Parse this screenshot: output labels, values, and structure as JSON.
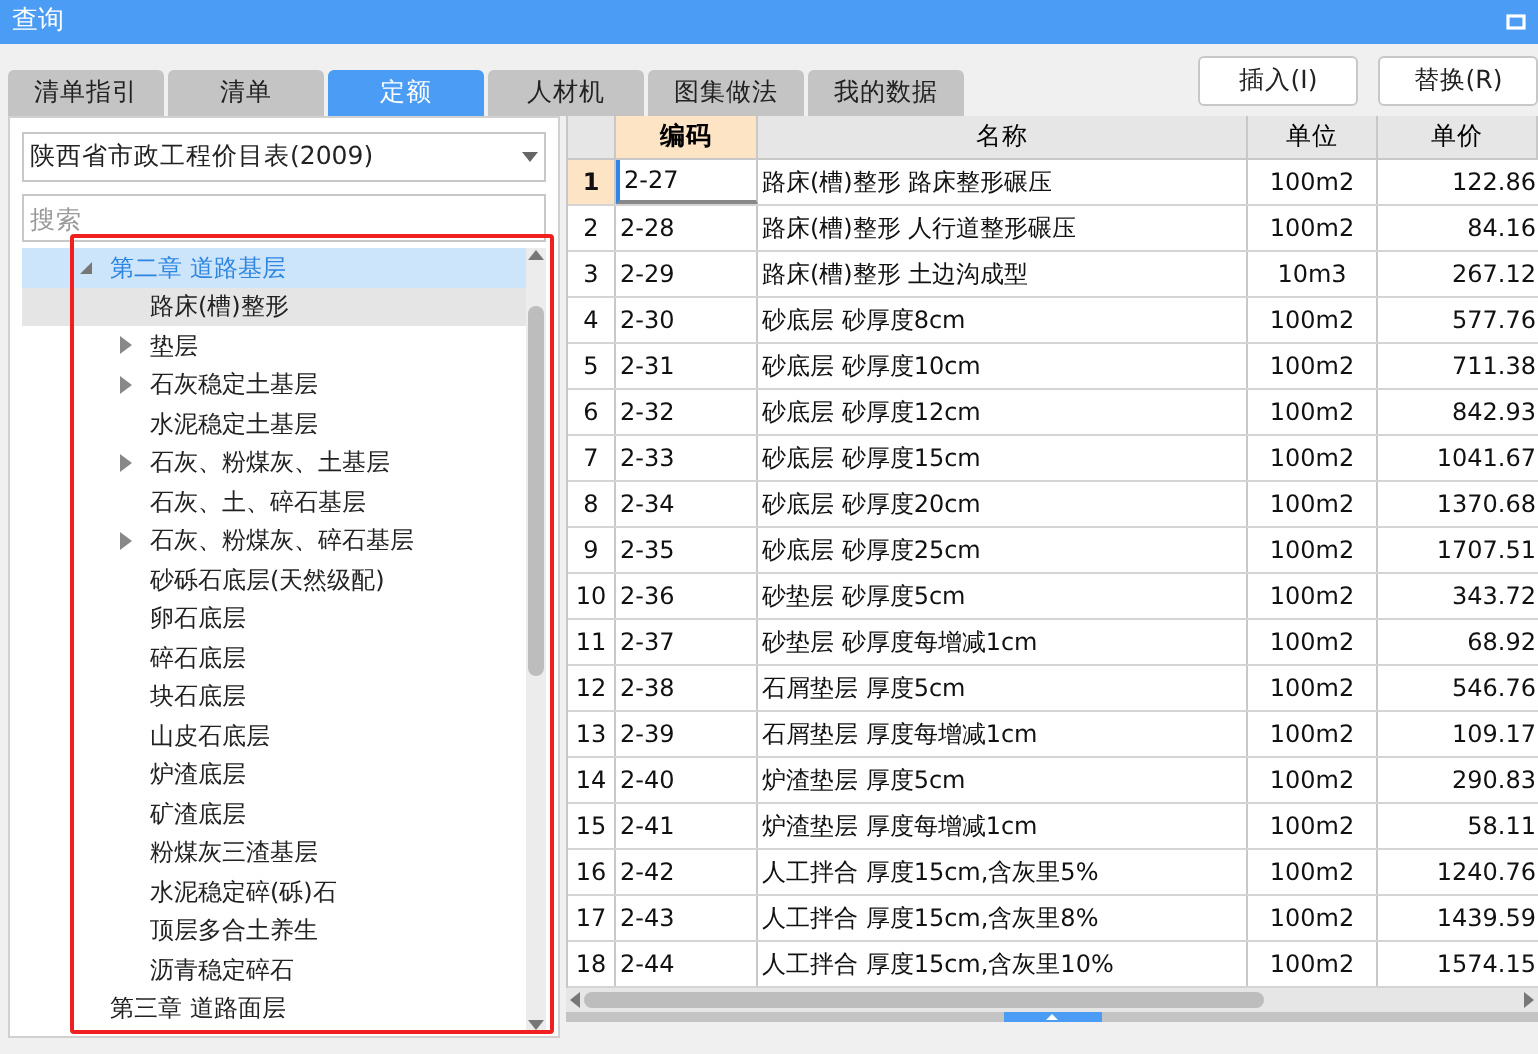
{
  "window": {
    "title": "查询"
  },
  "tabs": [
    {
      "label": "清单指引",
      "selected": false
    },
    {
      "label": "清单",
      "selected": false
    },
    {
      "label": "定额",
      "selected": true
    },
    {
      "label": "人材机",
      "selected": false
    },
    {
      "label": "图集做法",
      "selected": false
    },
    {
      "label": "我的数据",
      "selected": false
    }
  ],
  "buttons": [
    "插入(I)",
    "替换(R)"
  ],
  "library_select": {
    "value": "陕西省市政工程价目表(2009)"
  },
  "search": {
    "placeholder": "搜索"
  },
  "tree": [
    {
      "label": "第二章 道路基层",
      "kind": "group",
      "expanded": true,
      "selected": true,
      "hovered": false,
      "children": [
        {
          "label": "路床(槽)整形",
          "kind": "item",
          "selected": false,
          "hovered": true
        },
        {
          "label": "垫层",
          "kind": "group",
          "expanded": false,
          "selected": false,
          "hovered": false
        },
        {
          "label": "石灰稳定土基层",
          "kind": "group",
          "expanded": false,
          "selected": false,
          "hovered": false
        },
        {
          "label": "水泥稳定土基层",
          "kind": "item",
          "selected": false,
          "hovered": false
        },
        {
          "label": "石灰、粉煤灰、土基层",
          "kind": "group",
          "expanded": false,
          "selected": false,
          "hovered": false
        },
        {
          "label": "石灰、土、碎石基层",
          "kind": "item",
          "selected": false,
          "hovered": false
        },
        {
          "label": "石灰、粉煤灰、碎石基层",
          "kind": "group",
          "expanded": false,
          "selected": false,
          "hovered": false
        },
        {
          "label": "砂砾石底层(天然级配)",
          "kind": "item",
          "selected": false,
          "hovered": false
        },
        {
          "label": "卵石底层",
          "kind": "item",
          "selected": false,
          "hovered": false
        },
        {
          "label": "碎石底层",
          "kind": "item",
          "selected": false,
          "hovered": false
        },
        {
          "label": "块石底层",
          "kind": "item",
          "selected": false,
          "hovered": false
        },
        {
          "label": "山皮石底层",
          "kind": "item",
          "selected": false,
          "hovered": false
        },
        {
          "label": "炉渣底层",
          "kind": "item",
          "selected": false,
          "hovered": false
        },
        {
          "label": "矿渣底层",
          "kind": "item",
          "selected": false,
          "hovered": false
        },
        {
          "label": "粉煤灰三渣基层",
          "kind": "item",
          "selected": false,
          "hovered": false
        },
        {
          "label": "水泥稳定碎(砾)石",
          "kind": "item",
          "selected": false,
          "hovered": false
        },
        {
          "label": "顶层多合土养生",
          "kind": "item",
          "selected": false,
          "hovered": false
        },
        {
          "label": "沥青稳定碎石",
          "kind": "item",
          "selected": false,
          "hovered": false
        }
      ]
    },
    {
      "label": "第三章 道路面层",
      "kind": "item",
      "selected": false,
      "hovered": false
    }
  ],
  "table": {
    "columns": [
      {
        "label": "编码",
        "selected": true
      },
      {
        "label": "名称",
        "selected": false
      },
      {
        "label": "单位",
        "selected": false
      },
      {
        "label": "单价",
        "selected": false
      }
    ],
    "rows": [
      {
        "num": "1",
        "code": "2-27",
        "name": "路床(槽)整形 路床整形碾压",
        "unit": "100m2",
        "price": "122.86",
        "selected": true
      },
      {
        "num": "2",
        "code": "2-28",
        "name": "路床(槽)整形 人行道整形碾压",
        "unit": "100m2",
        "price": "84.16",
        "selected": false
      },
      {
        "num": "3",
        "code": "2-29",
        "name": "路床(槽)整形 土边沟成型",
        "unit": "10m3",
        "price": "267.12",
        "selected": false
      },
      {
        "num": "4",
        "code": "2-30",
        "name": "砂底层 砂厚度8cm",
        "unit": "100m2",
        "price": "577.76",
        "selected": false
      },
      {
        "num": "5",
        "code": "2-31",
        "name": "砂底层 砂厚度10cm",
        "unit": "100m2",
        "price": "711.38",
        "selected": false
      },
      {
        "num": "6",
        "code": "2-32",
        "name": "砂底层 砂厚度12cm",
        "unit": "100m2",
        "price": "842.93",
        "selected": false
      },
      {
        "num": "7",
        "code": "2-33",
        "name": "砂底层 砂厚度15cm",
        "unit": "100m2",
        "price": "1041.67",
        "selected": false
      },
      {
        "num": "8",
        "code": "2-34",
        "name": "砂底层 砂厚度20cm",
        "unit": "100m2",
        "price": "1370.68",
        "selected": false
      },
      {
        "num": "9",
        "code": "2-35",
        "name": "砂底层 砂厚度25cm",
        "unit": "100m2",
        "price": "1707.51",
        "selected": false
      },
      {
        "num": "10",
        "code": "2-36",
        "name": "砂垫层 砂厚度5cm",
        "unit": "100m2",
        "price": "343.72",
        "selected": false
      },
      {
        "num": "11",
        "code": "2-37",
        "name": "砂垫层 砂厚度每增减1cm",
        "unit": "100m2",
        "price": "68.92",
        "selected": false
      },
      {
        "num": "12",
        "code": "2-38",
        "name": "石屑垫层 厚度5cm",
        "unit": "100m2",
        "price": "546.76",
        "selected": false
      },
      {
        "num": "13",
        "code": "2-39",
        "name": "石屑垫层 厚度每增减1cm",
        "unit": "100m2",
        "price": "109.17",
        "selected": false
      },
      {
        "num": "14",
        "code": "2-40",
        "name": "炉渣垫层 厚度5cm",
        "unit": "100m2",
        "price": "290.83",
        "selected": false
      },
      {
        "num": "15",
        "code": "2-41",
        "name": "炉渣垫层 厚度每增减1cm",
        "unit": "100m2",
        "price": "58.11",
        "selected": false
      },
      {
        "num": "16",
        "code": "2-42",
        "name": "人工拌合 厚度15cm,含灰里5%",
        "unit": "100m2",
        "price": "1240.76",
        "selected": false
      },
      {
        "num": "17",
        "code": "2-43",
        "name": "人工拌合 厚度15cm,含灰里8%",
        "unit": "100m2",
        "price": "1439.59",
        "selected": false
      },
      {
        "num": "18",
        "code": "2-44",
        "name": "人工拌合 厚度15cm,含灰里10%",
        "unit": "100m2",
        "price": "1574.15",
        "selected": false
      }
    ]
  }
}
